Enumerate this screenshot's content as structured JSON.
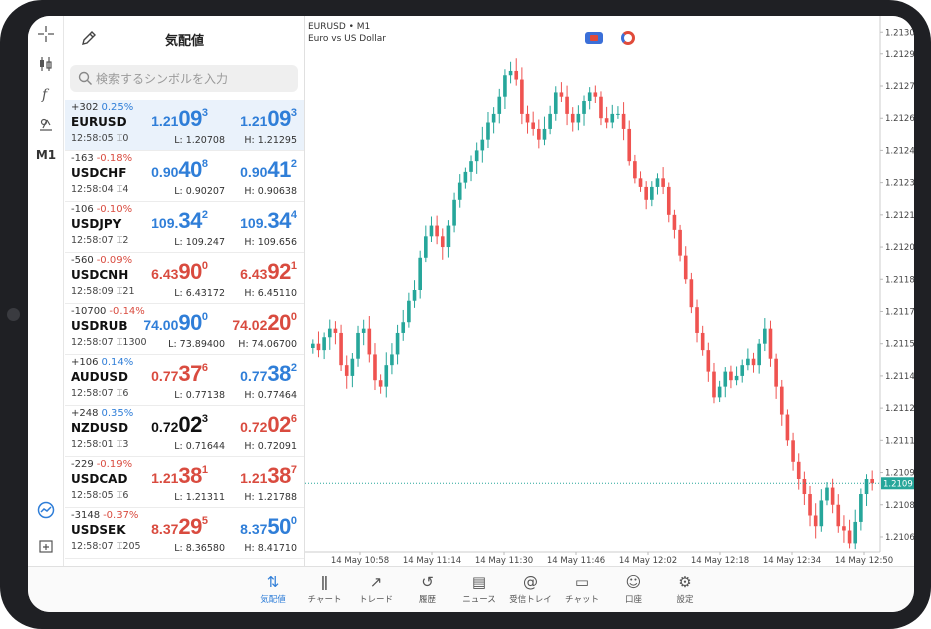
{
  "quotes": {
    "title": "気配値",
    "search_placeholder": "検索するシンボルを入力",
    "items": [
      {
        "change": "+302",
        "pct": "0.25%",
        "pct_color": "blue",
        "symbol": "EURUSD",
        "time": "12:58:05",
        "spread": "0",
        "bid": {
          "a": "1.21",
          "b": "09",
          "c": "3",
          "color": "blue"
        },
        "ask": {
          "a": "1.21",
          "b": "09",
          "c": "3",
          "color": "blue"
        },
        "low": "L: 1.20708",
        "high": "H: 1.21295"
      },
      {
        "change": "-163",
        "pct": "-0.18%",
        "pct_color": "red",
        "symbol": "USDCHF",
        "time": "12:58:04",
        "spread": "4",
        "bid": {
          "a": "0.90",
          "b": "40",
          "c": "8",
          "color": "blue"
        },
        "ask": {
          "a": "0.90",
          "b": "41",
          "c": "2",
          "color": "blue"
        },
        "low": "L: 0.90207",
        "high": "H: 0.90638"
      },
      {
        "change": "-106",
        "pct": "-0.10%",
        "pct_color": "red",
        "symbol": "USDJPY",
        "time": "12:58:07",
        "spread": "2",
        "bid": {
          "a": "109.",
          "b": "34",
          "c": "2",
          "color": "blue"
        },
        "ask": {
          "a": "109.",
          "b": "34",
          "c": "4",
          "color": "blue"
        },
        "low": "L: 109.247",
        "high": "H: 109.656"
      },
      {
        "change": "-560",
        "pct": "-0.09%",
        "pct_color": "red",
        "symbol": "USDCNH",
        "time": "12:58:09",
        "spread": "21",
        "bid": {
          "a": "6.43",
          "b": "90",
          "c": "0",
          "color": "red"
        },
        "ask": {
          "a": "6.43",
          "b": "92",
          "c": "1",
          "color": "red"
        },
        "low": "L: 6.43172",
        "high": "H: 6.45110"
      },
      {
        "change": "-10700",
        "pct": "-0.14%",
        "pct_color": "red",
        "symbol": "USDRUB",
        "time": "12:58:07",
        "spread": "1300",
        "bid": {
          "a": "74.00",
          "b": "90",
          "c": "0",
          "color": "blue"
        },
        "ask": {
          "a": "74.02",
          "b": "20",
          "c": "0",
          "color": "red"
        },
        "low": "L: 73.89400",
        "high": "H: 74.06700"
      },
      {
        "change": "+106",
        "pct": "0.14%",
        "pct_color": "blue",
        "symbol": "AUDUSD",
        "time": "12:58:07",
        "spread": "6",
        "bid": {
          "a": "0.77",
          "b": "37",
          "c": "6",
          "color": "red"
        },
        "ask": {
          "a": "0.77",
          "b": "38",
          "c": "2",
          "color": "blue"
        },
        "low": "L: 0.77138",
        "high": "H: 0.77464"
      },
      {
        "change": "+248",
        "pct": "0.35%",
        "pct_color": "blue",
        "symbol": "NZDUSD",
        "time": "12:58:01",
        "spread": "3",
        "bid": {
          "a": "0.72",
          "b": "02",
          "c": "3",
          "color": "black"
        },
        "ask": {
          "a": "0.72",
          "b": "02",
          "c": "6",
          "color": "red"
        },
        "low": "L: 0.71644",
        "high": "H: 0.72091"
      },
      {
        "change": "-229",
        "pct": "-0.19%",
        "pct_color": "red",
        "symbol": "USDCAD",
        "time": "12:58:05",
        "spread": "6",
        "bid": {
          "a": "1.21",
          "b": "38",
          "c": "1",
          "color": "red"
        },
        "ask": {
          "a": "1.21",
          "b": "38",
          "c": "7",
          "color": "red"
        },
        "low": "L: 1.21311",
        "high": "H: 1.21788"
      },
      {
        "change": "-3148",
        "pct": "-0.37%",
        "pct_color": "red",
        "symbol": "USDSEK",
        "time": "12:58:07",
        "spread": "205",
        "bid": {
          "a": "8.37",
          "b": "29",
          "c": "5",
          "color": "red"
        },
        "ask": {
          "a": "8.37",
          "b": "50",
          "c": "0",
          "color": "blue"
        },
        "low": "L: 8.36580",
        "high": "H: 8.41710"
      }
    ]
  },
  "chart": {
    "symbol_label": "EURUSD • M1",
    "description": "Euro vs US Dollar",
    "current_price": "1.2109",
    "y_ticks": [
      "1.21300",
      "1.21290",
      "1.21275",
      "1.21260",
      "1.21245",
      "1.21230",
      "1.21215",
      "1.21200",
      "1.21185",
      "1.21170",
      "1.21155",
      "1.21140",
      "1.21125",
      "1.21110",
      "1.21095",
      "1.21080",
      "1.21065"
    ],
    "x_ticks": [
      "14 May 10:58",
      "14 May 11:14",
      "14 May 11:30",
      "14 May 11:46",
      "14 May 12:02",
      "14 May 12:18",
      "14 May 12:34",
      "14 May 12:50"
    ],
    "up_color": "#26a69a",
    "down_color": "#ef5350"
  },
  "chart_data": {
    "type": "candlestick",
    "title": "EURUSD • M1",
    "subtitle": "Euro vs US Dollar",
    "x_label_start": "14 May 10:58",
    "x_label_end": "14 May 12:50",
    "ylim": [
      1.21058,
      1.21302
    ],
    "grid": false,
    "close_path": [
      1.21155,
      1.21152,
      1.21158,
      1.21162,
      1.2116,
      1.21145,
      1.2114,
      1.21148,
      1.2116,
      1.21162,
      1.2115,
      1.21138,
      1.21135,
      1.21145,
      1.2115,
      1.2116,
      1.21165,
      1.21175,
      1.2118,
      1.21195,
      1.21205,
      1.2121,
      1.21205,
      1.212,
      1.2121,
      1.21222,
      1.2123,
      1.21235,
      1.2124,
      1.21245,
      1.2125,
      1.21258,
      1.21262,
      1.2127,
      1.2128,
      1.21282,
      1.21278,
      1.21262,
      1.21258,
      1.21255,
      1.2125,
      1.21255,
      1.21262,
      1.21272,
      1.2127,
      1.21262,
      1.21258,
      1.21262,
      1.21268,
      1.21272,
      1.2127,
      1.2126,
      1.21258,
      1.21262,
      1.21262,
      1.21255,
      1.2124,
      1.21232,
      1.21228,
      1.21222,
      1.21228,
      1.21232,
      1.21228,
      1.21215,
      1.21208,
      1.21196,
      1.21185,
      1.21172,
      1.2116,
      1.21152,
      1.21142,
      1.2113,
      1.21135,
      1.21142,
      1.21138,
      1.2114,
      1.21145,
      1.21148,
      1.21145,
      1.21155,
      1.21162,
      1.21148,
      1.21135,
      1.21122,
      1.2111,
      1.211,
      1.21092,
      1.21085,
      1.21075,
      1.2107,
      1.21082,
      1.21088,
      1.2108,
      1.2107,
      1.21068,
      1.21062,
      1.21072,
      1.21085,
      1.21092,
      1.2109
    ],
    "last_price": "1.2109"
  },
  "toolbar": {
    "items": [
      "crosshair-icon",
      "candles-icon",
      "indicator-icon",
      "objects-icon",
      "M1",
      "chart-active-icon",
      "new-chart-icon"
    ],
    "timeframe_label": "M1"
  },
  "nav": {
    "items": [
      {
        "label": "気配値",
        "icon": "⇅"
      },
      {
        "label": "チャート",
        "icon": "ǁ"
      },
      {
        "label": "トレード",
        "icon": "↗"
      },
      {
        "label": "履歴",
        "icon": "↺"
      },
      {
        "label": "ニュース",
        "icon": "▤"
      },
      {
        "label": "受信トレイ",
        "icon": "@"
      },
      {
        "label": "チャット",
        "icon": "▭"
      },
      {
        "label": "口座",
        "icon": "☺"
      },
      {
        "label": "設定",
        "icon": "⚙"
      }
    ]
  }
}
